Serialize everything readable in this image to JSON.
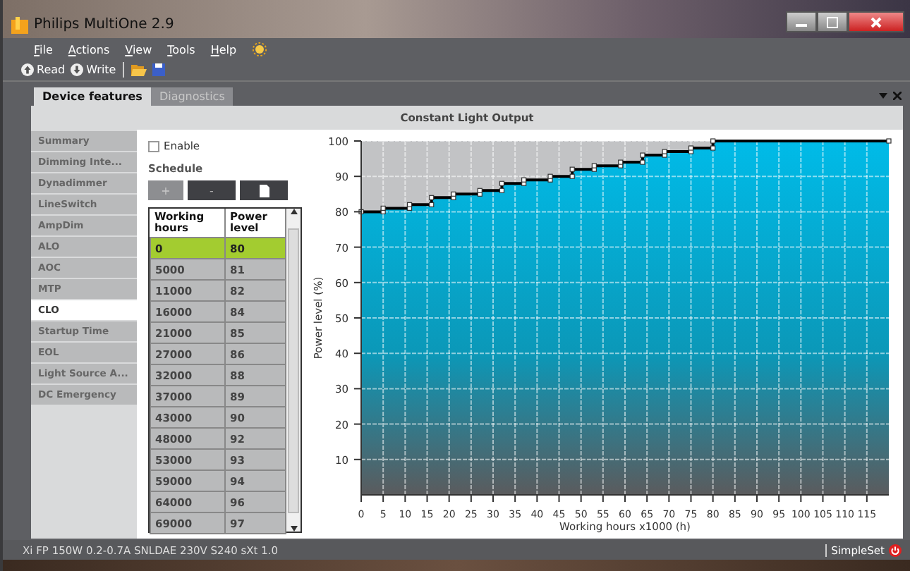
{
  "window": {
    "title": "Philips MultiOne 2.9"
  },
  "menu": [
    "File",
    "Actions",
    "View",
    "Tools",
    "Help"
  ],
  "toolbar": [
    {
      "kind": "read",
      "label": "Read"
    },
    {
      "kind": "write",
      "label": "Write"
    },
    {
      "kind": "open"
    },
    {
      "kind": "save"
    }
  ],
  "tabs": [
    {
      "label": "Device features",
      "selected": true
    },
    {
      "label": "Diagnostics",
      "selected": false
    }
  ],
  "panel_title": "Constant Light Output",
  "sidebar": {
    "items": [
      {
        "label": "Summary",
        "selected": false
      },
      {
        "label": "Dimming Inte...",
        "selected": false
      },
      {
        "label": "Dynadimmer",
        "selected": false
      },
      {
        "label": "LineSwitch",
        "selected": false
      },
      {
        "label": "AmpDim",
        "selected": false
      },
      {
        "label": "ALO",
        "selected": false
      },
      {
        "label": "AOC",
        "selected": false
      },
      {
        "label": "MTP",
        "selected": false
      },
      {
        "label": "CLO",
        "selected": true
      },
      {
        "label": "Startup Time",
        "selected": false
      },
      {
        "label": "EOL",
        "selected": false
      },
      {
        "label": "Light Source A...",
        "selected": false
      },
      {
        "label": "DC Emergency",
        "selected": false
      }
    ]
  },
  "enable": {
    "label": "Enable",
    "checked": false
  },
  "schedule": {
    "title": "Schedule",
    "buttons": [
      {
        "kind": "add",
        "label": "+",
        "disabled": true
      },
      {
        "kind": "remove",
        "label": "-",
        "disabled": false
      },
      {
        "kind": "page"
      }
    ],
    "table": {
      "columns": [
        "Working hours",
        "Power level"
      ],
      "rows": [
        {
          "cells": [
            "0",
            "80"
          ],
          "selected": true
        },
        {
          "cells": [
            "5000",
            "81"
          ],
          "selected": false
        },
        {
          "cells": [
            "11000",
            "82"
          ],
          "selected": false
        },
        {
          "cells": [
            "16000",
            "84"
          ],
          "selected": false
        },
        {
          "cells": [
            "21000",
            "85"
          ],
          "selected": false
        },
        {
          "cells": [
            "27000",
            "86"
          ],
          "selected": false
        },
        {
          "cells": [
            "32000",
            "88"
          ],
          "selected": false
        },
        {
          "cells": [
            "37000",
            "89"
          ],
          "selected": false
        },
        {
          "cells": [
            "43000",
            "90"
          ],
          "selected": false
        },
        {
          "cells": [
            "48000",
            "92"
          ],
          "selected": false
        },
        {
          "cells": [
            "53000",
            "93"
          ],
          "selected": false
        },
        {
          "cells": [
            "59000",
            "94"
          ],
          "selected": false
        },
        {
          "cells": [
            "64000",
            "96"
          ],
          "selected": false
        },
        {
          "cells": [
            "69000",
            "97"
          ],
          "selected": false
        }
      ]
    }
  },
  "chart_data": {
    "type": "line",
    "xlabel": "Working hours x1000 (h)",
    "ylabel": "Power level (%)",
    "x": [
      0,
      5,
      5,
      11,
      11,
      16,
      16,
      21,
      21,
      27,
      27,
      32,
      32,
      37,
      37,
      43,
      43,
      48,
      48,
      53,
      53,
      59,
      59,
      64,
      64,
      69,
      69,
      75,
      75,
      80,
      80,
      120
    ],
    "series": [
      {
        "color": "#000000",
        "marker": "square",
        "values": [
          80,
          80,
          81,
          81,
          82,
          82,
          84,
          84,
          85,
          85,
          86,
          86,
          88,
          88,
          89,
          89,
          90,
          90,
          92,
          92,
          93,
          93,
          94,
          94,
          96,
          96,
          97,
          97,
          98,
          98,
          100,
          100
        ]
      }
    ],
    "grid": true,
    "xlim": [
      0,
      120
    ],
    "ylim": [
      0,
      100
    ],
    "xticks": [
      0,
      5,
      10,
      15,
      20,
      25,
      30,
      35,
      40,
      45,
      50,
      55,
      60,
      65,
      70,
      75,
      80,
      85,
      90,
      95,
      100,
      105,
      110,
      115
    ],
    "yticks": [
      10,
      20,
      30,
      40,
      50,
      60,
      70,
      80,
      90,
      100
    ]
  },
  "status_bar": {
    "device": "Xi FP 150W 0.2-0.7A SNLDAE 230V S240 sXt 1.0",
    "mode": "SimpleSet"
  }
}
